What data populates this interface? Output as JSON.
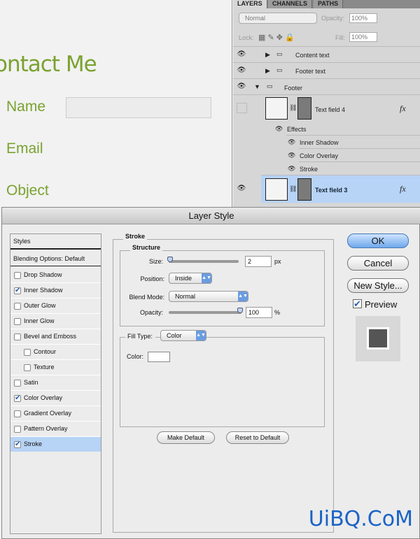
{
  "web": {
    "heading": "ontact Me",
    "labels": [
      "Name",
      "Email",
      "Object"
    ]
  },
  "layers_panel": {
    "tabs": [
      "LAYERS",
      "CHANNELS",
      "PATHS"
    ],
    "blend_mode": "Normal",
    "opacity_label": "Opacity:",
    "opacity": "100%",
    "lock_label": "Lock:",
    "fill_label": "Fill:",
    "fill": "100%",
    "layers": [
      {
        "name": "Content text",
        "type": "group",
        "expanded": false,
        "visible": true
      },
      {
        "name": "Footer text",
        "type": "group",
        "expanded": false,
        "visible": true
      },
      {
        "name": "Footer",
        "type": "group",
        "expanded": true,
        "visible": true
      },
      {
        "name": "Text field 4",
        "type": "layer",
        "visible": false,
        "fx": "fx"
      },
      {
        "name": "Text field 3",
        "type": "layer",
        "visible": true,
        "selected": true,
        "fx": "fx"
      }
    ],
    "effects_label": "Effects",
    "effects": [
      "Inner Shadow",
      "Color Overlay",
      "Stroke"
    ]
  },
  "dialog": {
    "title": "Layer Style",
    "styles_header": "Styles",
    "blending_options": "Blending Options: Default",
    "styles": [
      {
        "label": "Drop Shadow",
        "checked": false
      },
      {
        "label": "Inner Shadow",
        "checked": true
      },
      {
        "label": "Outer Glow",
        "checked": false
      },
      {
        "label": "Inner Glow",
        "checked": false
      },
      {
        "label": "Bevel and Emboss",
        "checked": false
      },
      {
        "label": "Contour",
        "checked": false,
        "indent": true
      },
      {
        "label": "Texture",
        "checked": false,
        "indent": true
      },
      {
        "label": "Satin",
        "checked": false
      },
      {
        "label": "Color Overlay",
        "checked": true
      },
      {
        "label": "Gradient Overlay",
        "checked": false
      },
      {
        "label": "Pattern Overlay",
        "checked": false
      },
      {
        "label": "Stroke",
        "checked": true,
        "selected": true
      }
    ],
    "stroke": {
      "group_label": "Stroke",
      "structure_label": "Structure",
      "size_label": "Size:",
      "size": "2",
      "size_unit": "px",
      "position_label": "Position:",
      "position": "Inside",
      "blend_label": "Blend Mode:",
      "blend": "Normal",
      "opacity_label": "Opacity:",
      "opacity": "100",
      "opacity_unit": "%",
      "fill_type_label": "Fill Type:",
      "fill_type": "Color",
      "color_label": "Color:",
      "color": "#ffffff"
    },
    "make_default": "Make Default",
    "reset_default": "Reset to Default",
    "ok": "OK",
    "cancel": "Cancel",
    "new_style": "New Style...",
    "preview_label": "Preview",
    "preview_checked": true
  },
  "watermark": "UiBQ.CoM",
  "colors": {
    "accent_green": "#7aa230",
    "selection": "#b7d3f6",
    "ok_blue": "#6fa8ec"
  }
}
